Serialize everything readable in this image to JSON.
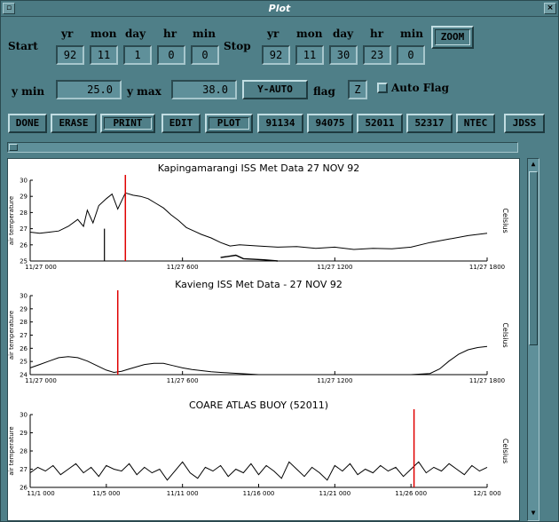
{
  "window": {
    "title": "Plot",
    "menu_glyph": "▫",
    "close_glyph": "×"
  },
  "start": {
    "label": "Start",
    "yr_label": "yr",
    "mon_label": "mon",
    "day_label": "day",
    "hr_label": "hr",
    "min_label": "min",
    "yr": "92",
    "mon": "11",
    "day": "1",
    "hr": "0",
    "min": "0"
  },
  "stop": {
    "label": "Stop",
    "yr_label": "yr",
    "mon_label": "mon",
    "day_label": "day",
    "hr_label": "hr",
    "min_label": "min",
    "yr": "92",
    "mon": "11",
    "day": "30",
    "hr": "23",
    "min": "0"
  },
  "zoom_label": "ZOOM",
  "yrange": {
    "ymin_label": "y min",
    "ymin": "25.0",
    "ymax_label": "y max",
    "ymax": "38.0",
    "yauto_label": "Y-AUTO",
    "flag_label": "flag",
    "flag": "Z",
    "autoflag_label": "Auto Flag"
  },
  "actions": {
    "done": "DONE",
    "erase": "ERASE",
    "print": "PRINT",
    "edit": "EDIT",
    "plot": "PLOT",
    "b1": "91134",
    "b2": "94075",
    "b3": "52011",
    "b4": "52317",
    "ntec": "NTEC",
    "jdss": "JDSS"
  },
  "colors": {
    "window_bg": "#4f7f88",
    "field_bg": "#5f909a",
    "cursor_red": "#e00000"
  },
  "icons": {
    "menu": "window-menu-icon",
    "close": "window-close-icon",
    "scroll_up": "arrow-up-icon",
    "scroll_down": "arrow-down-icon"
  },
  "chart_data": [
    {
      "type": "line",
      "title": "Kapingamarangi ISS Met Data    27 NOV 92",
      "ylabel": "air temperature",
      "right_label": "Celsius",
      "ylim": [
        24,
        31
      ],
      "yticks": [
        "30",
        "29",
        "28",
        "27",
        "26",
        "25"
      ],
      "xticks": [
        "11/27 000",
        "11/27 600",
        "11/27 1200",
        "11/27 1800"
      ],
      "xlim": [
        0,
        24
      ],
      "cursor_x": 5,
      "series": [
        {
          "x": [
            0,
            0.5,
            1,
            1.5,
            2,
            2.5,
            2.8,
            3,
            3.3,
            3.6,
            4,
            4.3,
            4.6,
            5,
            5.4,
            5.8,
            6.2,
            6.6,
            7,
            7.4,
            7.8,
            8.2,
            8.6,
            9,
            9.5,
            10,
            10.5,
            11,
            12,
            13,
            14,
            15,
            16,
            17,
            18,
            19,
            20,
            21,
            22,
            23,
            24
          ],
          "y": [
            26.5,
            26.4,
            26.5,
            26.6,
            27.0,
            27.6,
            27.0,
            28.4,
            27.3,
            28.8,
            29.4,
            29.8,
            28.5,
            29.9,
            29.7,
            29.6,
            29.4,
            29.0,
            28.6,
            28.0,
            27.5,
            26.9,
            26.6,
            26.3,
            26.0,
            25.6,
            25.3,
            25.4,
            25.3,
            25.2,
            25.25,
            25.1,
            25.2,
            25.0,
            25.1,
            25.05,
            25.2,
            25.6,
            25.9,
            26.2,
            26.4
          ]
        }
      ],
      "annotations": [
        {
          "type": "vertical-line",
          "x": 3.9,
          "y0": 24.0,
          "y1": 26.8
        },
        {
          "type": "arrow-path",
          "x": [
            10,
            10.8,
            11.2,
            12.3,
            13.0
          ],
          "y": [
            24.3,
            24.5,
            24.2,
            24.1,
            24.0
          ]
        }
      ]
    },
    {
      "type": "line",
      "title": "Kavieng ISS Met Data - 27 NOV 92",
      "ylabel": "air temperature",
      "right_label": "Celsius",
      "ylim": [
        24,
        31
      ],
      "yticks": [
        "30",
        "29",
        "28",
        "27",
        "26",
        "25",
        "24"
      ],
      "xticks": [
        "11/27 000",
        "11/27 600",
        "11/27 1200",
        "11/27 1800"
      ],
      "xlim": [
        0,
        24
      ],
      "cursor_x": 4.6,
      "series": [
        {
          "x": [
            0,
            0.5,
            1,
            1.5,
            2,
            2.5,
            3,
            3.5,
            4,
            4.4,
            4.8,
            5.2,
            5.6,
            6,
            6.5,
            7,
            7.5,
            8,
            8.5,
            9,
            9.5,
            10,
            10.5,
            11,
            11.5,
            12,
            13,
            14,
            15,
            16,
            17,
            18,
            19,
            20,
            21,
            21.5,
            22,
            22.5,
            23,
            23.5,
            24
          ],
          "y": [
            24.6,
            24.9,
            25.2,
            25.5,
            25.6,
            25.5,
            25.2,
            24.8,
            24.4,
            24.2,
            24.3,
            24.5,
            24.7,
            24.9,
            25.0,
            25.0,
            24.8,
            24.6,
            24.45,
            24.35,
            24.25,
            24.2,
            24.15,
            24.1,
            24.05,
            24.0,
            24.0,
            24.0,
            24.0,
            24.0,
            24.0,
            24.0,
            24.0,
            24.0,
            24.1,
            24.5,
            25.2,
            25.8,
            26.2,
            26.4,
            26.5
          ]
        }
      ]
    },
    {
      "type": "line",
      "title": "COARE ATLAS BUOY    (52011)",
      "ylabel": "air temperature",
      "right_label": "Celsius",
      "ylim": [
        26,
        30
      ],
      "yticks": [
        "30",
        "29",
        "28",
        "27",
        "26"
      ],
      "xticks": [
        "11/1 000",
        "11/5 000",
        "11/11 000",
        "11/16 000",
        "11/21 000",
        "11/26 000",
        "12/1 000"
      ],
      "xlim": [
        0,
        30
      ],
      "cursor_x": 25.2,
      "series": [
        {
          "x": [
            0,
            0.5,
            1,
            1.5,
            2,
            2.5,
            3,
            3.5,
            4,
            4.5,
            5,
            5.5,
            6,
            6.5,
            7,
            7.5,
            8,
            8.5,
            9,
            9.5,
            10,
            10.5,
            11,
            11.5,
            12,
            12.5,
            13,
            13.5,
            14,
            14.5,
            15,
            15.5,
            16,
            16.5,
            17,
            17.5,
            18,
            18.5,
            19,
            19.5,
            20,
            20.5,
            21,
            21.5,
            22,
            22.5,
            23,
            23.5,
            24,
            24.5,
            25,
            25.5,
            26,
            26.5,
            27,
            27.5,
            28,
            28.5,
            29,
            29.5,
            30
          ],
          "y": [
            26.8,
            27.1,
            26.9,
            27.2,
            26.7,
            27.0,
            27.3,
            26.8,
            27.1,
            26.6,
            27.2,
            27.0,
            26.9,
            27.3,
            26.7,
            27.1,
            26.8,
            27.0,
            26.4,
            26.9,
            27.4,
            26.8,
            26.5,
            27.1,
            26.9,
            27.2,
            26.6,
            27.0,
            26.8,
            27.3,
            26.7,
            27.2,
            26.9,
            26.5,
            27.4,
            27.0,
            26.6,
            27.1,
            26.8,
            26.4,
            27.2,
            26.9,
            27.3,
            26.7,
            27.0,
            26.8,
            27.2,
            26.9,
            27.1,
            26.6,
            27.0,
            27.4,
            26.8,
            27.1,
            26.9,
            27.3,
            27.0,
            26.7,
            27.2,
            26.9,
            27.1
          ]
        }
      ]
    }
  ]
}
